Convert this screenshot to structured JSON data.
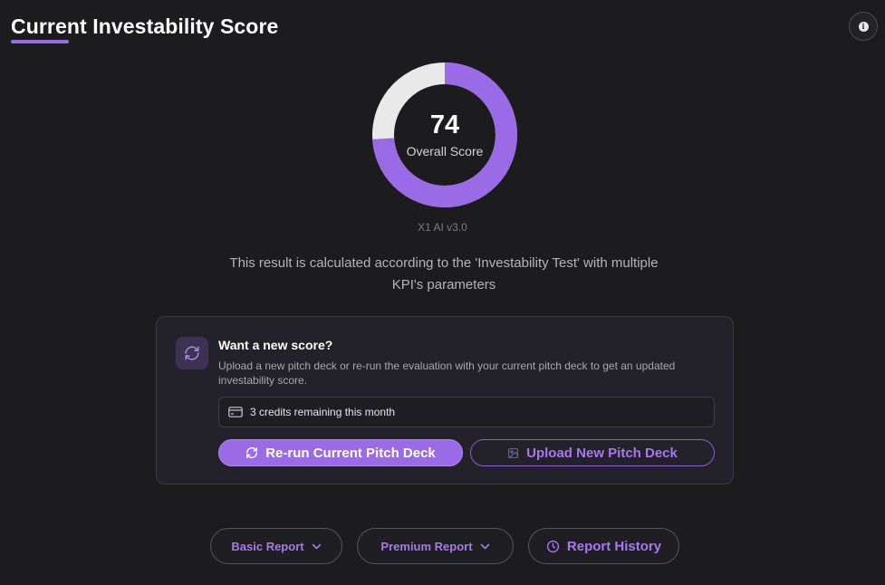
{
  "header": {
    "title": "Current Investability Score"
  },
  "score": {
    "value": "74",
    "fraction": 0.74,
    "label": "Overall Score",
    "version": "X1 AI v3.0",
    "colors": {
      "fill": "#9b6ae6",
      "track": "#e9e9ea"
    }
  },
  "description": "This result is calculated according to the 'Investability Test' with multiple KPI's parameters",
  "card": {
    "title": "Want a new score?",
    "description": "Upload a new pitch deck or re-run the evaluation with your current pitch deck to get an updated investability score.",
    "credits": "3 credits remaining this month",
    "rerun_label": "Re-run Current Pitch Deck",
    "upload_label": "Upload New Pitch Deck"
  },
  "reports": {
    "basic_label": "Basic Report",
    "premium_label": "Premium Report",
    "history_label": "Report History"
  },
  "icons": {
    "info": "info-icon",
    "refresh": "refresh-icon",
    "card": "credit-card-icon",
    "image": "image-icon",
    "chevron": "chevron-down-icon",
    "clock": "clock-icon"
  },
  "accent": "#9b6ae6"
}
